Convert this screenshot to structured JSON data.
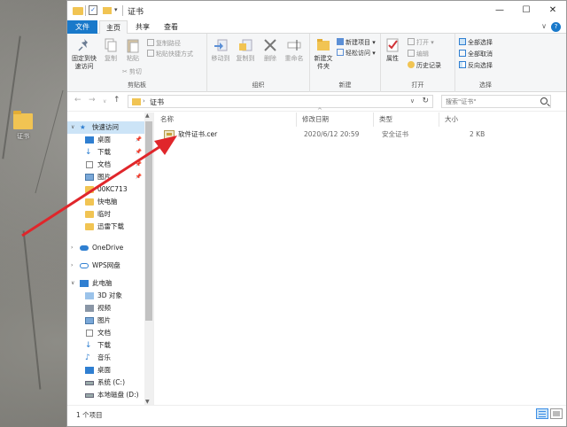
{
  "window": {
    "title": "证书"
  },
  "ribbon_tabs": [
    "文件",
    "主页",
    "共享",
    "查看"
  ],
  "ribbon": {
    "clipboard": {
      "pin_label": "固定到快速访问",
      "copy_label": "复制",
      "paste_label": "粘贴",
      "copy_path_label": "复制路径",
      "paste_shortcut_label": "粘贴快捷方式",
      "cut_label": "剪切",
      "group_label": "剪贴板"
    },
    "organize": {
      "move_to_label": "移动到",
      "copy_to_label": "复制到",
      "delete_label": "删除",
      "rename_label": "重命名",
      "group_label": "组织"
    },
    "new": {
      "new_folder_label": "新建文件夹",
      "new_item_label": "新建项目",
      "easy_access_label": "轻松访问",
      "group_label": "新建"
    },
    "open": {
      "properties_label": "属性",
      "open_label": "打开",
      "edit_label": "编辑",
      "history_label": "历史记录",
      "group_label": "打开"
    },
    "select": {
      "select_all_label": "全部选择",
      "select_none_label": "全部取消",
      "invert_label": "反向选择",
      "group_label": "选择"
    }
  },
  "address": {
    "path": "证书",
    "search_placeholder": "搜索\"证书\""
  },
  "nav": {
    "items": [
      {
        "label": "快速访问",
        "icon": "star-icon"
      },
      {
        "label": "桌面",
        "icon": "desktop-icon",
        "pinned": true
      },
      {
        "label": "下载",
        "icon": "download-icon",
        "pinned": true
      },
      {
        "label": "文档",
        "icon": "document-icon",
        "pinned": true
      },
      {
        "label": "图片",
        "icon": "picture-icon",
        "pinned": true
      },
      {
        "label": "00KC713",
        "icon": "folder-icon"
      },
      {
        "label": "快电脑",
        "icon": "folder-icon"
      },
      {
        "label": "临时",
        "icon": "folder-icon"
      },
      {
        "label": "迅雷下载",
        "icon": "folder-icon"
      },
      {
        "label": "OneDrive",
        "icon": "cloud-icon"
      },
      {
        "label": "WPS网盘",
        "icon": "cloud-icon"
      },
      {
        "label": "此电脑",
        "icon": "computer-icon"
      },
      {
        "label": "3D 对象",
        "icon": "cube-icon"
      },
      {
        "label": "视频",
        "icon": "video-icon"
      },
      {
        "label": "图片",
        "icon": "picture-icon"
      },
      {
        "label": "文档",
        "icon": "document-icon"
      },
      {
        "label": "下载",
        "icon": "download-icon"
      },
      {
        "label": "音乐",
        "icon": "music-icon"
      },
      {
        "label": "桌面",
        "icon": "desktop-icon"
      },
      {
        "label": "系统 (C:)",
        "icon": "drive-icon"
      },
      {
        "label": "本地磁盘 (D:)",
        "icon": "drive-icon"
      }
    ]
  },
  "columns": [
    "名称",
    "修改日期",
    "类型",
    "大小"
  ],
  "files": [
    {
      "name": "软件证书.cer",
      "modified": "2020/6/12 20:59",
      "type": "安全证书",
      "size": "2 KB"
    }
  ],
  "status": {
    "count": "1 个项目"
  },
  "desktop": {
    "icon_label": "证书"
  },
  "colors": {
    "accent": "#1979ca",
    "arrow": "#e0262b",
    "folder": "#f1c453"
  }
}
